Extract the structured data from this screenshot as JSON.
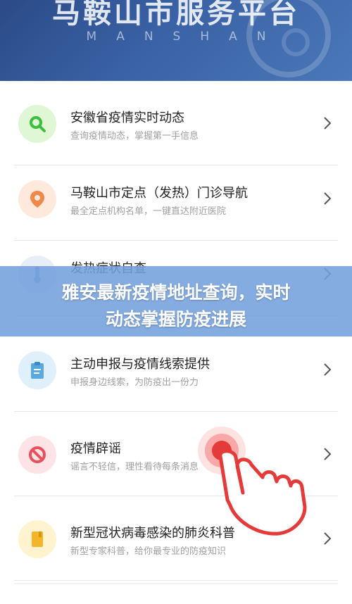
{
  "header": {
    "title": "马鞍山市服务平台",
    "subtitle": "MANSHAN"
  },
  "overlay": {
    "line1": "雅安最新疫情地址查询，实时",
    "line2": "动态掌握防疫进展"
  },
  "items": [
    {
      "title": "安徽省疫情实时动态",
      "desc": "查询疫情动态，掌握第一手信息",
      "icon": "search-icon",
      "color": "#dff7d4",
      "icon_color": "#3cbf3c"
    },
    {
      "title": "马鞍山市定点（发热）门诊导航",
      "desc": "最全定点机构名单，一键直达附近医院",
      "icon": "location-pin-icon",
      "color": "#ffe9dc",
      "icon_color": "#f08848"
    },
    {
      "title": "发热症状自查",
      "desc": "",
      "icon": "thermometer-icon",
      "color": "#e8eef8",
      "icon_color": "#7fa0d8"
    },
    {
      "title": "主动申报与疫情线索提供",
      "desc": "申报身边线索，为防疫出一份力",
      "icon": "clipboard-icon",
      "color": "#dff0fb",
      "icon_color": "#5aa8e0"
    },
    {
      "title": "疫情辟谣",
      "desc": "谣言不轻信，理性看待每条消息",
      "icon": "ban-icon",
      "color": "#fde3e5",
      "icon_color": "#e8505f"
    },
    {
      "title": "新型冠状病毒感染的肺炎科普",
      "desc": "新型专家科普，给你最专业的防疫知识",
      "icon": "book-icon",
      "color": "#fff4cf",
      "icon_color": "#f5b52a"
    }
  ]
}
